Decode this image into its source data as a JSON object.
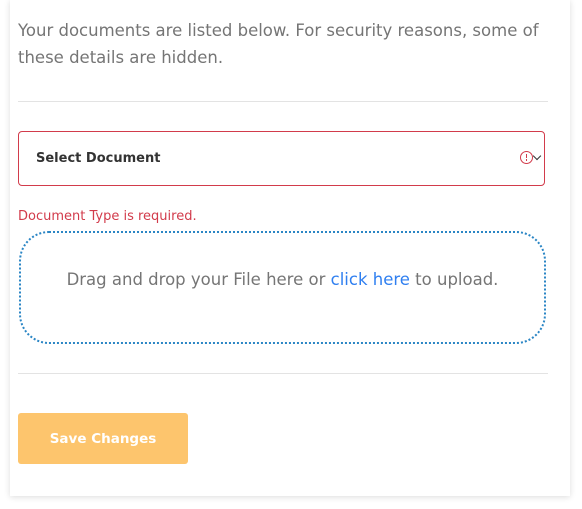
{
  "intro": {
    "text": "Your documents are listed below. For security reasons, some of these details are hidden."
  },
  "document_select": {
    "placeholder": "Select Document",
    "error": "Document Type is required.",
    "icons": [
      "error-icon",
      "chevron-down-icon"
    ]
  },
  "dropzone": {
    "prefix": "Drag and drop your File here or ",
    "link": "click here",
    "suffix": " to upload."
  },
  "actions": {
    "save_label": "Save Changes"
  },
  "colors": {
    "error": "#d23b4b",
    "dropzone_border": "#2b86c5",
    "link": "#2f7ff0",
    "button_bg_disabled": "#fdc56d",
    "body_text": "#757575"
  }
}
